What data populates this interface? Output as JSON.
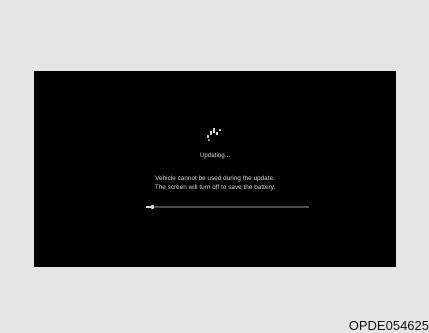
{
  "screen": {
    "status_title": "Updating...",
    "message_line1": "Vehicle cannot be used during the update.",
    "message_line2": "The screen will turn off to save the battery.",
    "progress_fraction": 0.04
  },
  "figure": {
    "code": "OPDE054625"
  },
  "colors": {
    "page_background": "#e5e5e5",
    "screen_background": "#000000",
    "text": "#d9d9d9",
    "progress_track": "#4a4a4a",
    "progress_fill": "#d8d8d8"
  }
}
